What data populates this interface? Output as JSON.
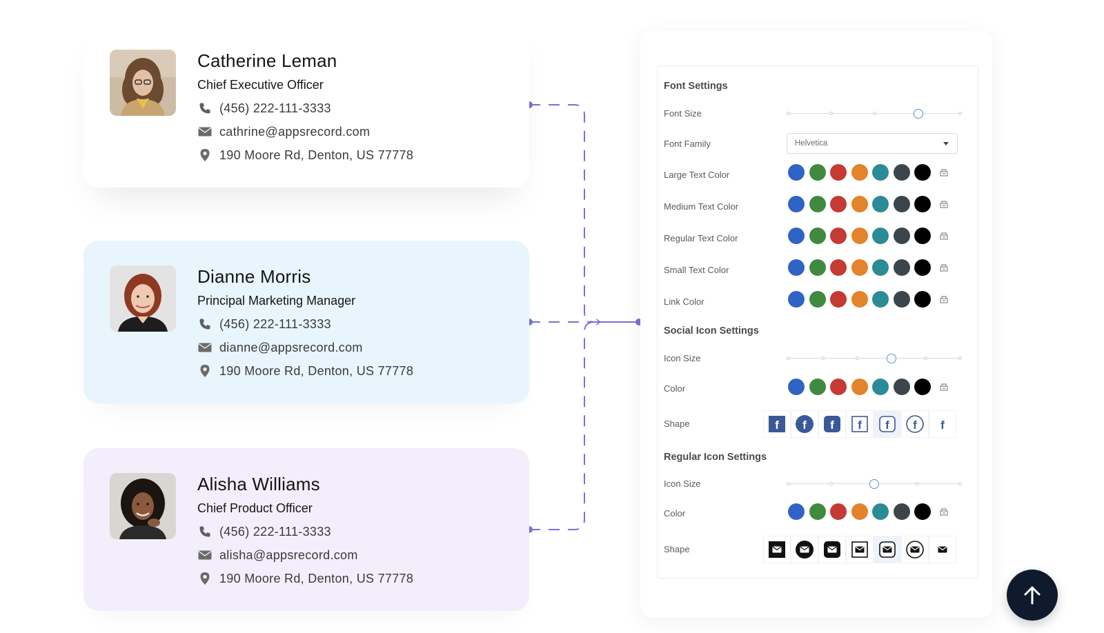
{
  "cards": [
    {
      "name": "Catherine Leman",
      "title": "Chief Executive Officer",
      "phone": "(456) 222-111-3333",
      "email": "cathrine@appsrecord.com",
      "address": "190 Moore Rd, Denton, US 77778"
    },
    {
      "name": "Dianne Morris",
      "title": "Principal Marketing Manager",
      "phone": "(456) 222-111-3333",
      "email": "dianne@appsrecord.com",
      "address": "190 Moore Rd, Denton, US 77778"
    },
    {
      "name": "Alisha Williams",
      "title": "Chief Product Officer",
      "phone": "(456) 222-111-3333",
      "email": "alisha@appsrecord.com",
      "address": "190 Moore Rd, Denton, US 77778"
    }
  ],
  "settings": {
    "font": {
      "section_title": "Font Settings",
      "size_label": "Font Size",
      "size_level": 0.75,
      "family_label": "Font Family",
      "family_value": "Helvetica",
      "color_rows": [
        "Large Text Color",
        "Medium Text Color",
        "Regular Text Color",
        "Small Text Color",
        "Link Color"
      ]
    },
    "social": {
      "section_title": "Social Icon Settings",
      "size_label": "Icon Size",
      "size_level": 0.6,
      "color_label": "Color",
      "shape_label": "Shape",
      "shape_icons": [
        "facebook-square-icon",
        "facebook-circle-icon",
        "facebook-rounded-icon",
        "facebook-outline-square-icon",
        "facebook-outline-rounded-icon",
        "facebook-outline-circle-icon",
        "facebook-plain-icon"
      ],
      "selected_shape": 4
    },
    "regular": {
      "section_title": "Regular Icon Settings",
      "size_label": "Icon Size",
      "size_level": 0.5,
      "color_label": "Color",
      "shape_label": "Shape",
      "shape_icons": [
        "mail-square-icon",
        "mail-circle-icon",
        "mail-rounded-icon",
        "mail-outline-square-icon",
        "mail-outline-rounded-icon",
        "mail-outline-circle-icon",
        "mail-plain-icon"
      ],
      "selected_shape": 4
    },
    "swatch_colors": [
      "#2f63c6",
      "#3f8a3f",
      "#c53a32",
      "#e3832b",
      "#2b8b97",
      "#3c454d",
      "#000000"
    ]
  },
  "colors": {
    "connector": "#7b6fd6",
    "accent_thumb": "#5b8fd1",
    "fab_bg": "#0f1a2d"
  },
  "scroll_top_icon": "arrow-up-icon"
}
